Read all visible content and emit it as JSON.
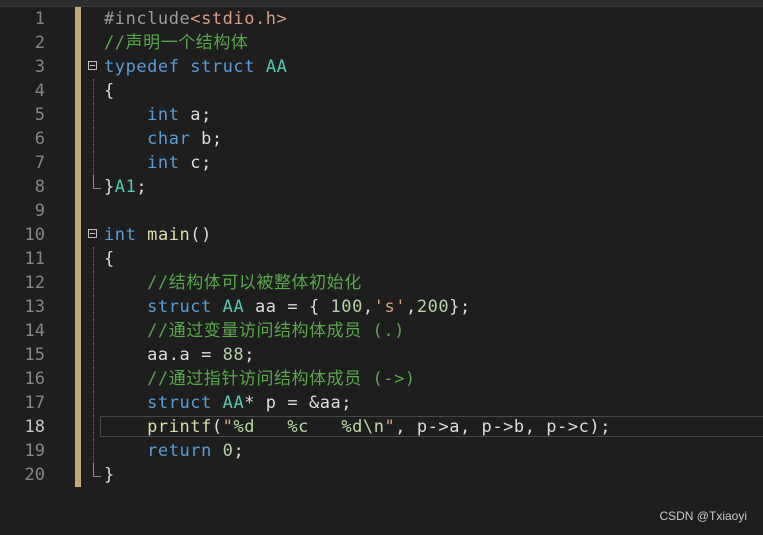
{
  "editor": {
    "language": "c",
    "current_line": 18,
    "lines": [
      {
        "n": "1",
        "segments": [
          {
            "t": "#include",
            "c": "pp"
          },
          {
            "t": "<stdio.h>",
            "c": "str"
          }
        ]
      },
      {
        "n": "2",
        "segments": [
          {
            "t": "//声明一个结构体",
            "c": "com"
          }
        ]
      },
      {
        "n": "3",
        "segments": [
          {
            "t": "typedef",
            "c": "kw"
          },
          {
            "t": " ",
            "c": ""
          },
          {
            "t": "struct",
            "c": "kw"
          },
          {
            "t": " ",
            "c": ""
          },
          {
            "t": "AA",
            "c": "ty"
          }
        ]
      },
      {
        "n": "4",
        "segments": [
          {
            "t": "{",
            "c": ""
          }
        ]
      },
      {
        "n": "5",
        "segments": [
          {
            "t": "    ",
            "c": ""
          },
          {
            "t": "int",
            "c": "kw"
          },
          {
            "t": " a;",
            "c": ""
          }
        ]
      },
      {
        "n": "6",
        "segments": [
          {
            "t": "    ",
            "c": ""
          },
          {
            "t": "char",
            "c": "kw"
          },
          {
            "t": " b;",
            "c": ""
          }
        ]
      },
      {
        "n": "7",
        "segments": [
          {
            "t": "    ",
            "c": ""
          },
          {
            "t": "int",
            "c": "kw"
          },
          {
            "t": " c;",
            "c": ""
          }
        ]
      },
      {
        "n": "8",
        "segments": [
          {
            "t": "}",
            "c": ""
          },
          {
            "t": "A1",
            "c": "ty"
          },
          {
            "t": ";",
            "c": ""
          }
        ]
      },
      {
        "n": "9",
        "segments": []
      },
      {
        "n": "10",
        "segments": [
          {
            "t": "int",
            "c": "kw"
          },
          {
            "t": " ",
            "c": ""
          },
          {
            "t": "main",
            "c": "fn"
          },
          {
            "t": "()",
            "c": ""
          }
        ]
      },
      {
        "n": "11",
        "segments": [
          {
            "t": "{",
            "c": ""
          }
        ]
      },
      {
        "n": "12",
        "segments": [
          {
            "t": "    ",
            "c": ""
          },
          {
            "t": "//结构体可以被整体初始化",
            "c": "com"
          }
        ]
      },
      {
        "n": "13",
        "segments": [
          {
            "t": "    ",
            "c": ""
          },
          {
            "t": "struct",
            "c": "kw"
          },
          {
            "t": " ",
            "c": ""
          },
          {
            "t": "AA",
            "c": "ty"
          },
          {
            "t": " aa = { ",
            "c": ""
          },
          {
            "t": "100",
            "c": "num"
          },
          {
            "t": ",",
            "c": ""
          },
          {
            "t": "'s'",
            "c": "str"
          },
          {
            "t": ",",
            "c": ""
          },
          {
            "t": "200",
            "c": "num"
          },
          {
            "t": "};",
            "c": ""
          }
        ]
      },
      {
        "n": "14",
        "segments": [
          {
            "t": "    ",
            "c": ""
          },
          {
            "t": "//通过变量访问结构体成员 (.)",
            "c": "com"
          }
        ]
      },
      {
        "n": "15",
        "segments": [
          {
            "t": "    aa.a = ",
            "c": ""
          },
          {
            "t": "88",
            "c": "num"
          },
          {
            "t": ";",
            "c": ""
          }
        ]
      },
      {
        "n": "16",
        "segments": [
          {
            "t": "    ",
            "c": ""
          },
          {
            "t": "//通过指针访问结构体成员 (->)",
            "c": "com"
          }
        ]
      },
      {
        "n": "17",
        "segments": [
          {
            "t": "    ",
            "c": ""
          },
          {
            "t": "struct",
            "c": "kw"
          },
          {
            "t": " ",
            "c": ""
          },
          {
            "t": "AA",
            "c": "ty"
          },
          {
            "t": "* p = &aa;",
            "c": ""
          }
        ]
      },
      {
        "n": "18",
        "segments": [
          {
            "t": "    ",
            "c": ""
          },
          {
            "t": "printf",
            "c": "fn"
          },
          {
            "t": "(",
            "c": ""
          },
          {
            "t": "\"",
            "c": "str"
          },
          {
            "t": "%d",
            "c": "fmt"
          },
          {
            "t": "   ",
            "c": "str"
          },
          {
            "t": "%c",
            "c": "fmt"
          },
          {
            "t": "   ",
            "c": "str"
          },
          {
            "t": "%d",
            "c": "fmt"
          },
          {
            "t": "\\n",
            "c": "fmt"
          },
          {
            "t": "\"",
            "c": "str"
          },
          {
            "t": ", p->a, p->b, p->c);",
            "c": ""
          }
        ]
      },
      {
        "n": "19",
        "segments": [
          {
            "t": "    ",
            "c": ""
          },
          {
            "t": "return",
            "c": "kw"
          },
          {
            "t": " ",
            "c": ""
          },
          {
            "t": "0",
            "c": "num"
          },
          {
            "t": ";",
            "c": ""
          }
        ]
      },
      {
        "n": "20",
        "segments": [
          {
            "t": "}",
            "c": ""
          }
        ]
      }
    ]
  },
  "watermark": "CSDN @Txiaoyi",
  "colors": {
    "background": "#1e1e1e",
    "keyword": "#569cd6",
    "type": "#4ec9b0",
    "string": "#d69d85",
    "comment": "#57a64a",
    "number": "#b5cea8",
    "change_bar": "#e2c08d"
  },
  "icons": {
    "fold_toggle": "collapse-minus-icon"
  }
}
